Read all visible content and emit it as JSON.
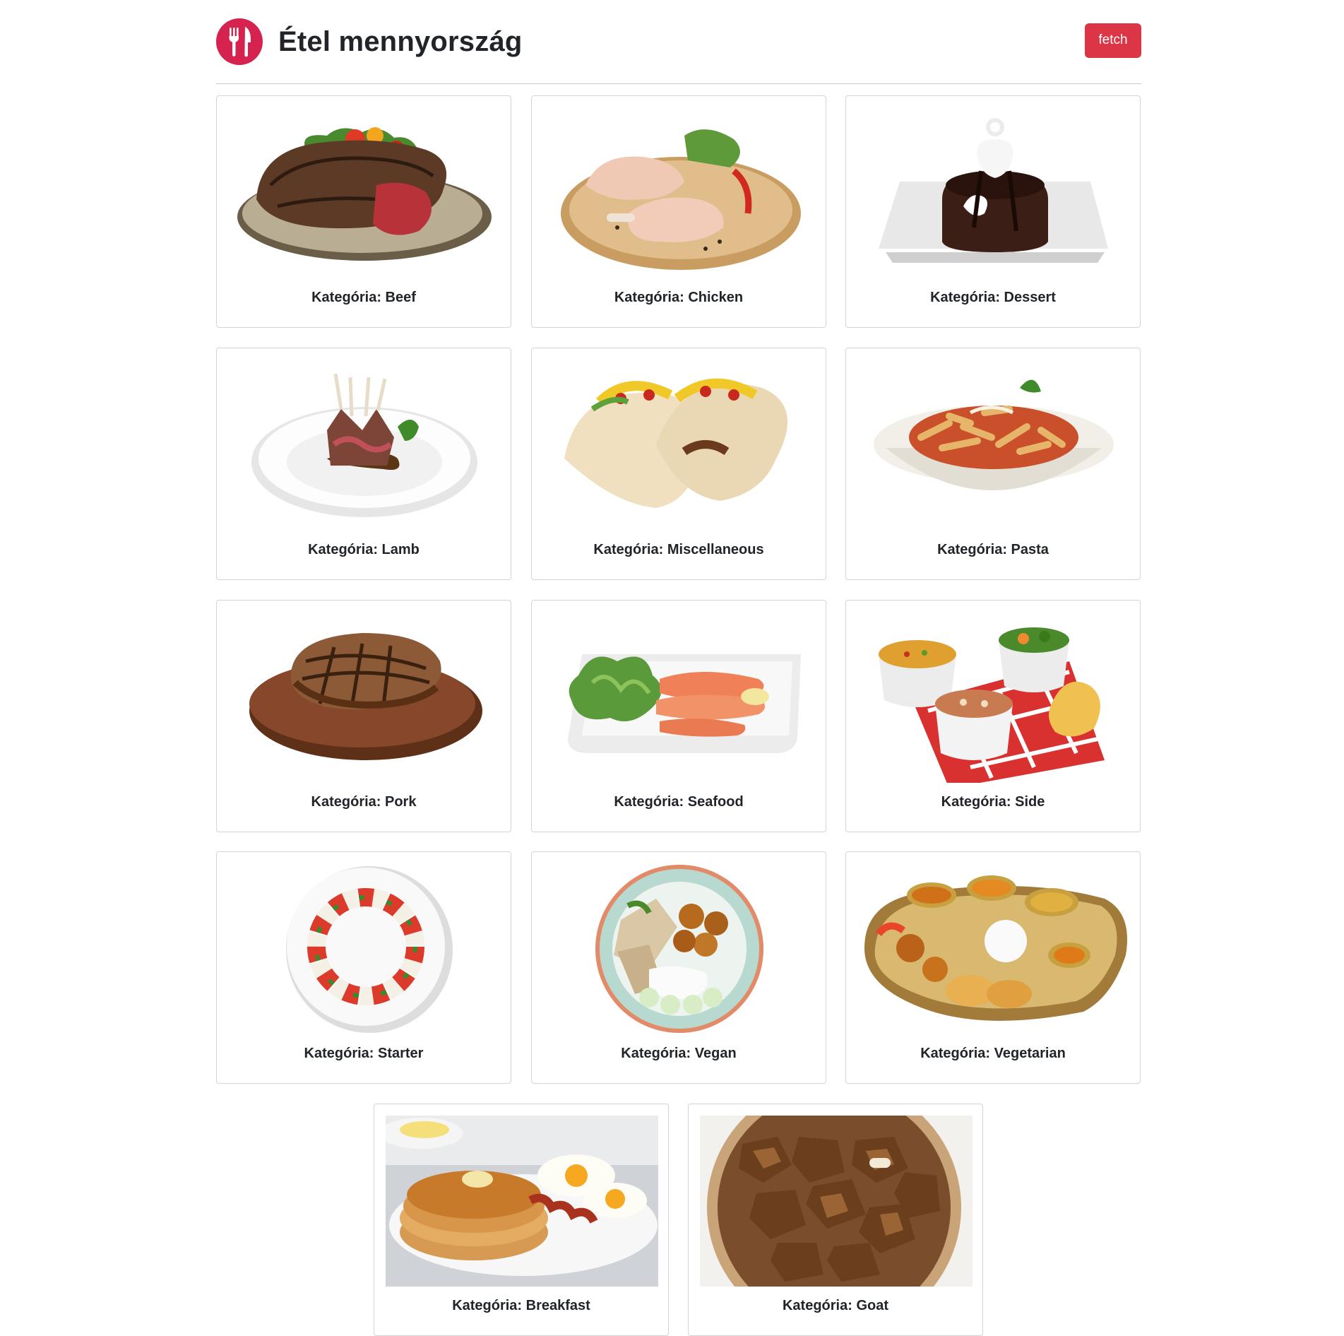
{
  "app": {
    "title": "Étel mennyország",
    "logo_icon": "fork-knife-icon",
    "brand_color": "#d6224f"
  },
  "header": {
    "fetch_label": "fetch",
    "fetch_color": "#dc3545"
  },
  "cards": [
    {
      "caption": "Kategória: Beef",
      "image": "beef-steak-plate-image"
    },
    {
      "caption": "Kategória: Chicken",
      "image": "raw-chicken-legs-image"
    },
    {
      "caption": "Kategória: Dessert",
      "image": "chocolate-cake-dessert-image"
    },
    {
      "caption": "Kategória: Lamb",
      "image": "lamb-rack-plate-image"
    },
    {
      "caption": "Kategória: Miscellaneous",
      "image": "tacos-image"
    },
    {
      "caption": "Kategória: Pasta",
      "image": "penne-pasta-bowl-image"
    },
    {
      "caption": "Kategória: Pork",
      "image": "pork-chop-board-image"
    },
    {
      "caption": "Kategória: Seafood",
      "image": "salmon-salad-plate-image"
    },
    {
      "caption": "Kategória: Side",
      "image": "side-dishes-bowls-image"
    },
    {
      "caption": "Kategória: Starter",
      "image": "caprese-salad-plate-image"
    },
    {
      "caption": "Kategória: Vegan",
      "image": "vegan-bowl-image"
    },
    {
      "caption": "Kategória: Vegetarian",
      "image": "vegetarian-thali-image"
    },
    {
      "caption": "Kategória: Breakfast",
      "image": "pancakes-eggs-bacon-image"
    },
    {
      "caption": "Kategória: Goat",
      "image": "goat-meat-bowl-image"
    }
  ]
}
